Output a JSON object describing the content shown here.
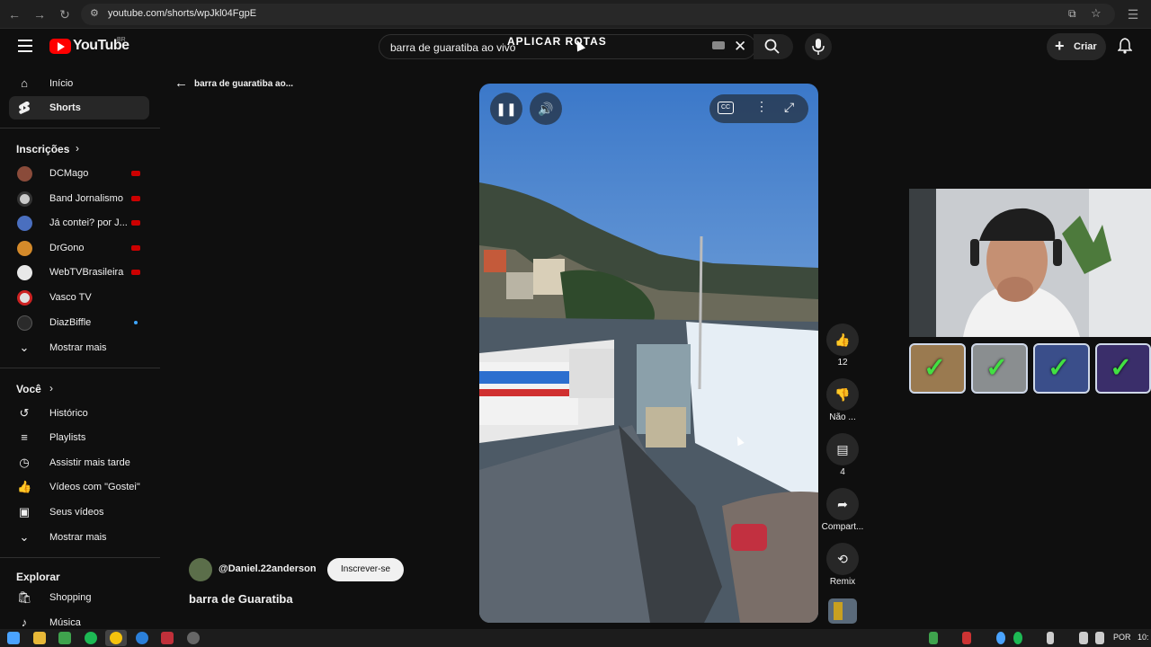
{
  "browser": {
    "url": "youtube.com/shorts/wpJkl04FgpE"
  },
  "header": {
    "logo_text": "YouTube",
    "region": "BR",
    "search_value": "barra de guaratiba ao vivo",
    "overlay_text": "APLICAR ROTAS",
    "create_label": "Criar"
  },
  "sidebar": {
    "home": "Início",
    "shorts": "Shorts",
    "subscriptions_header": "Inscrições",
    "channels": [
      {
        "name": "DCMago",
        "color": "#8a4b3a",
        "live": true
      },
      {
        "name": "Band Jornalismo",
        "color": "#c9c9c9",
        "live": true
      },
      {
        "name": "Já contei? por J...",
        "color": "#4a6fbf",
        "live": true
      },
      {
        "name": "DrGono",
        "color": "#d48a2a",
        "live": true
      },
      {
        "name": "WebTVBrasileira",
        "color": "#e8e8e8",
        "live": true
      },
      {
        "name": "Vasco TV",
        "color": "#e0e0e0",
        "live": false
      },
      {
        "name": "DiazBiffle",
        "color": "#2a2a2a",
        "live": false
      }
    ],
    "show_more": "Mostrar mais",
    "you_header": "Você",
    "you_items": [
      "Histórico",
      "Playlists",
      "Assistir mais tarde",
      "Vídeos com \"Gostei\"",
      "Seus vídeos",
      "Mostrar mais"
    ],
    "explore_header": "Explorar",
    "explore_items": [
      "Shopping",
      "Música"
    ]
  },
  "main": {
    "back_title": "barra de guaratiba ao...",
    "channel_handle": "@Daniel.22anderson",
    "subscribe_label": "Inscrever-se",
    "video_title": "barra de Guaratiba",
    "actions": {
      "likes": "12",
      "dislike": "Não ...",
      "comments": "4",
      "share": "Compart...",
      "remix": "Remix"
    }
  },
  "taskbar": {
    "lang": "POR",
    "time": "10:"
  }
}
